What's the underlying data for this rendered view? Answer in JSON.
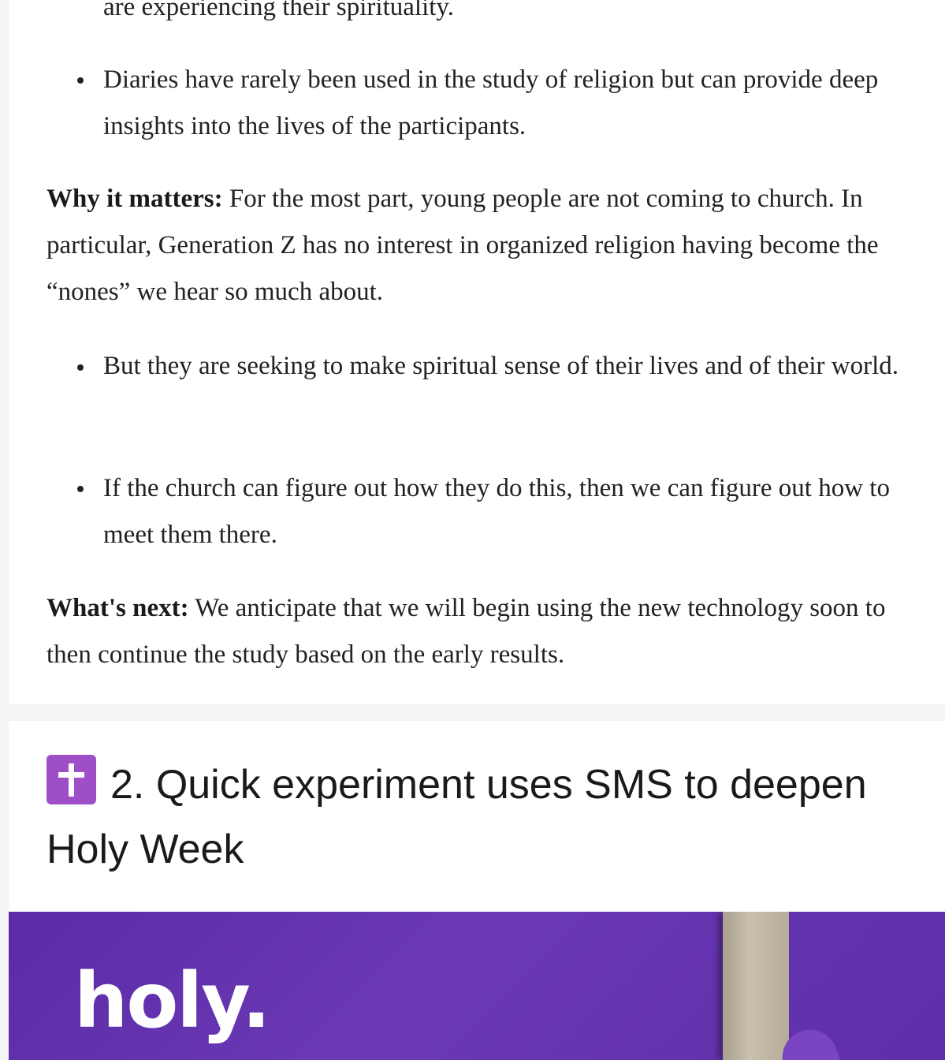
{
  "section1": {
    "top_partial": "are experiencing their spirituality.",
    "bullet_diaries": "Diaries have rarely been used in the study of religion but can provide deep insights into the lives of the participants.",
    "why_label": "Why it matters:",
    "why_text": " For the most part, young people are not coming to church. In particular, Generation Z has no interest in organized religion having become the “nones” we hear so much about.",
    "bullet_seeking": "But they are seeking to make spiritual sense of their lives and of their world.",
    "bullet_church": "If the church can figure out how they do this, then we can figure out how to meet them there.",
    "next_label": "What's next:",
    "next_text": " We anticipate that we will begin using the new technology soon to then continue the study based on the early results."
  },
  "section2": {
    "icon": "latin-cross-icon",
    "title": "2. Quick experiment uses SMS to deepen Holy Week",
    "hero_text": "holy."
  },
  "colors": {
    "background": "#f4f4f4",
    "card": "#ffffff",
    "text": "#222222",
    "icon_purple": "#9e4fc8",
    "hero_purple": "#5b2ba6"
  }
}
